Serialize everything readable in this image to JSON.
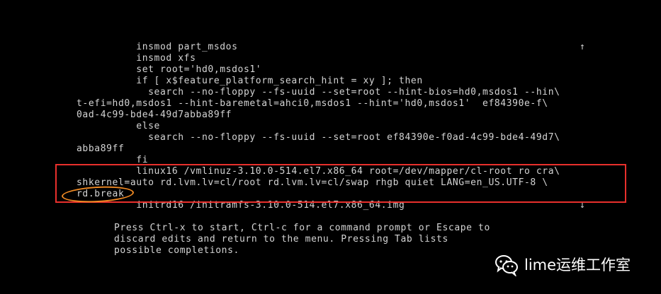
{
  "editor": {
    "scroll_up": "↑",
    "scroll_down": "↓",
    "lines": [
      "          insmod part_msdos",
      "          insmod xfs",
      "          set root='hd0,msdos1'",
      "          if [ x$feature_platform_search_hint = xy ]; then",
      "            search --no-floppy --fs-uuid --set=root --hint-bios=hd0,msdos1 --hin\\",
      "t-efi=hd0,msdos1 --hint-baremetal=ahci0,msdos1 --hint='hd0,msdos1'  ef84390e-f\\",
      "0ad-4c99-bde4-49d7abba89ff",
      "          else",
      "            search --no-floppy --fs-uuid --set=root ef84390e-f0ad-4c99-bde4-49d7\\",
      "abba89ff",
      "          fi",
      "          linux16 /vmlinuz-3.10.0-514.el7.x86_64 root=/dev/mapper/cl-root ro cra\\",
      "shkernel=auto rd.lvm.lv=cl/root rd.lvm.lv=cl/swap rhgb quiet LANG=en_US.UTF-8 \\",
      "rd.break",
      "          initrd16 /initramfs-3.10.0-514.el7.x86_64.img"
    ]
  },
  "footer": {
    "lines": [
      "Press Ctrl-x to start, Ctrl-c for a command prompt or Escape to",
      "discard edits and return to the menu. Pressing Tab lists",
      "possible completions."
    ]
  },
  "watermark": {
    "text": "lime运维工作室",
    "icon": "wechat-icon"
  },
  "colors": {
    "background": "#000000",
    "text": "#d4d4d4",
    "highlight_box": "#e8302c",
    "circle_mark": "#f08a24"
  }
}
